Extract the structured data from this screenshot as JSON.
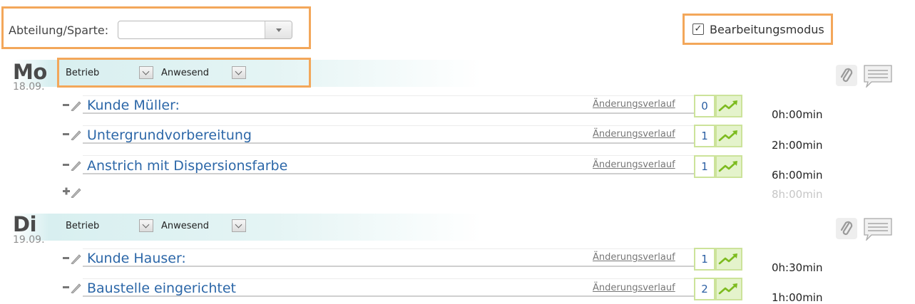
{
  "filter": {
    "label": "Abteilung/Sparte:",
    "value": ""
  },
  "edit_mode": {
    "label": "Bearbeitungsmodus",
    "checked": true,
    "check_glyph": "☑"
  },
  "days": [
    {
      "name": "Mo",
      "date": "18.09.",
      "type_label": "Betrieb",
      "status_label": "Anwesend",
      "entries": [
        {
          "title": "Kunde Müller:",
          "history_link": "Änderungsverlauf",
          "count": "0",
          "duration": "0h:00min"
        },
        {
          "title": "Untergrundvorbereitung",
          "history_link": "Änderungsverlauf",
          "count": "1",
          "duration": "2h:00min"
        },
        {
          "title": "Anstrich mit Dispersionsfarbe",
          "history_link": "Änderungsverlauf",
          "count": "1",
          "duration": "6h:00min"
        }
      ],
      "total": "8h:00min"
    },
    {
      "name": "Di",
      "date": "19.09.",
      "type_label": "Betrieb",
      "status_label": "Anwesend",
      "entries": [
        {
          "title": "Kunde Hauser:",
          "history_link": "Änderungsverlauf",
          "count": "1",
          "duration": "0h:30min"
        },
        {
          "title": "Baustelle eingerichtet",
          "history_link": "Änderungsverlauf",
          "count": "2",
          "duration": "1h:00min"
        }
      ]
    }
  ],
  "icons": {
    "attachment": "paperclip-icon",
    "note": "comment-icon",
    "remove_edit": "minus-pencil-icon",
    "add_edit": "plus-pencil-icon",
    "trend": "trend-up-icon",
    "dropdown": "chevron-down-icon"
  },
  "colors": {
    "highlight": "#f3a75a",
    "link": "#2c67a8",
    "trend_bg": "#e4f3cb",
    "trend_border": "#cce39a",
    "trend_arrow": "#7dbb1f"
  }
}
